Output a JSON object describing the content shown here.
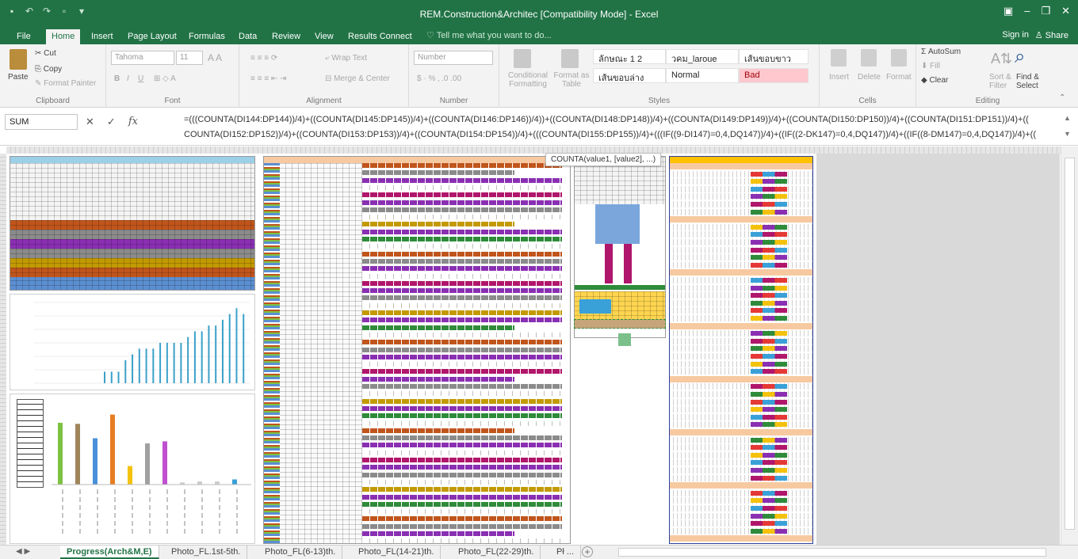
{
  "window": {
    "title": "REM.Construction&Architec  [Compatibility Mode] - Excel",
    "qat_icons": [
      "save-icon",
      "undo-icon",
      "redo-icon",
      "form-icon",
      "customize-icon"
    ],
    "controls": [
      "ribbon-display-icon",
      "minimize-icon",
      "restore-icon",
      "close-icon"
    ]
  },
  "tabs": {
    "items": [
      "File",
      "Home",
      "Insert",
      "Page Layout",
      "Formulas",
      "Data",
      "Review",
      "View",
      "Results Connect"
    ],
    "active": "Home",
    "tell_me": "Tell me what you want to do...",
    "sign_in": "Sign in",
    "share": "Share"
  },
  "ribbon": {
    "clipboard": {
      "paste": "Paste",
      "cut": "Cut",
      "copy": "Copy",
      "format_painter": "Format Painter",
      "label": "Clipboard"
    },
    "font": {
      "name": "Tahoma",
      "size": "11",
      "label": "Font",
      "bold": "B",
      "italic": "I",
      "underline": "U"
    },
    "alignment": {
      "wrap": "Wrap Text",
      "merge": "Merge & Center",
      "label": "Alignment"
    },
    "number": {
      "format": "Number",
      "label": "Number"
    },
    "styles": {
      "conditional": "Conditional Formatting",
      "format_table": "Format as Table",
      "cells": [
        "ลักษณะ 1 2",
        "วคม_laroue",
        "เส้นขอบขาว",
        "เส้นขอบล่าง",
        "Normal",
        "Bad"
      ],
      "label": "Styles"
    },
    "cells": {
      "insert": "Insert",
      "delete": "Delete",
      "format": "Format",
      "label": "Cells"
    },
    "editing": {
      "autosum": "AutoSum",
      "fill": "Fill",
      "clear": "Clear",
      "sort": "Sort & Filter",
      "find": "Find & Select",
      "label": "Editing"
    }
  },
  "formula_bar": {
    "name_box": "SUM",
    "line1": "=(((COUNTA(DI144:DP144))/4)+((COUNTA(DI145:DP145))/4)+((COUNTA(DI146:DP146))/4))+((COUNTA(DI148:DP148))/4)+((COUNTA(DI149:DP149))/4)+((COUNTA(DI150:DP150))/4)+((COUNTA(DI151:DP151))/4)+((",
    "line2": "COUNTA(DI152:DP152))/4)+((COUNTA(DI153:DP153))/4)+((COUNTA(DI154:DP154))/4)+(((COUNTA(DI155:DP155))/4)+(((IF((9-DI147)=0,4,DQ147))/4)+((IF((2-DK147)=0,4,DQ147))/4)+((IF((8-DM147)=0,4,DQ147))/4)+(("
  },
  "tooltip": "COUNTA(value1, [value2], ...)",
  "sheet_tabs": {
    "items": [
      "Progress(Arch&M,E)",
      "Photo_FL.1st-5th.",
      "Photo_FL(6-13)th.",
      "Photo_FL(14-21)th.",
      "Photo_FL(22-29)th.",
      "Pł ..."
    ],
    "active": "Progress(Arch&M,E)"
  },
  "colors": {
    "excel_green": "#217346",
    "band_colors": [
      "#c0551c",
      "#8b8b8b",
      "#8a2fb2",
      "#c29a00",
      "#5b8fd1",
      "#b0166b",
      "#2e8b3a"
    ]
  },
  "chart_data": [
    {
      "type": "bar",
      "values": [
        2,
        2,
        2,
        4,
        5,
        6,
        6,
        6,
        7,
        7,
        7,
        7,
        8,
        9,
        9,
        10,
        10,
        11,
        12,
        13,
        12
      ],
      "series": [
        {
          "values": [
            2,
            2,
            2,
            4,
            5,
            6,
            6,
            6,
            7,
            7,
            7,
            7,
            8,
            9,
            9,
            10,
            10,
            11,
            12,
            13,
            12
          ]
        }
      ]
    },
    {
      "type": "bar",
      "values": [
        60,
        59,
        45,
        68,
        18,
        40,
        42,
        2,
        3,
        3,
        5
      ],
      "colors": [
        "#7dc241",
        "#a0855b",
        "#4a90d9",
        "#e67e22",
        "#f4c20d",
        "#a0a0a0",
        "#c050d0",
        "#cccccc",
        "#cccccc",
        "#cccccc",
        "#3aa0d8"
      ]
    }
  ]
}
